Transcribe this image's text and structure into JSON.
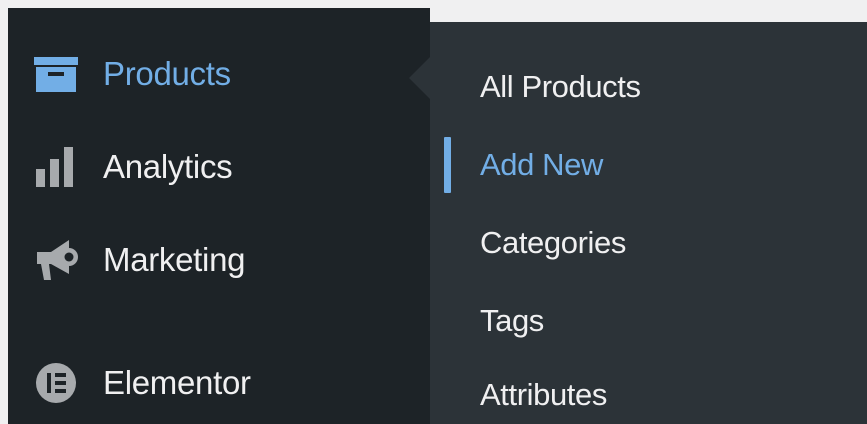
{
  "colors": {
    "menu_bg": "#1d2327",
    "submenu_bg": "#2c3338",
    "text": "#f0f0f1",
    "accent": "#72aee6",
    "icon": "#a7aaad"
  },
  "menu": {
    "items": [
      {
        "label": "Products",
        "icon": "archive-box-icon",
        "current": true
      },
      {
        "label": "Analytics",
        "icon": "bar-chart-icon",
        "current": false
      },
      {
        "label": "Marketing",
        "icon": "megaphone-icon",
        "current": false
      },
      {
        "label": "Elementor",
        "icon": "elementor-icon",
        "current": false
      }
    ]
  },
  "submenu": {
    "items": [
      {
        "label": "All Products",
        "current": false
      },
      {
        "label": "Add New",
        "current": true
      },
      {
        "label": "Categories",
        "current": false
      },
      {
        "label": "Tags",
        "current": false
      },
      {
        "label": "Attributes",
        "current": false
      }
    ]
  }
}
